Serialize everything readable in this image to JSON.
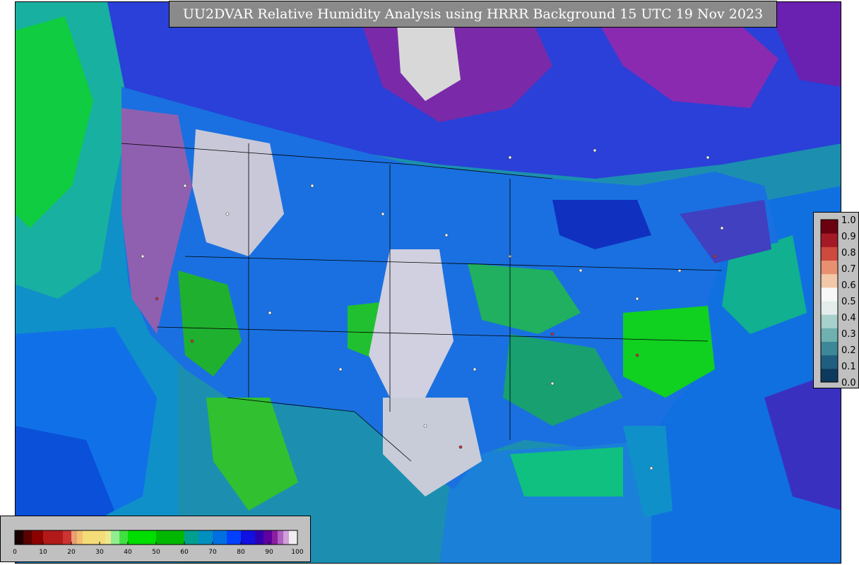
{
  "title": "UU2DVAR Relative Humidity Analysis using HRRR Background 15 UTC 19 Nov 2023",
  "rh_colorbar": {
    "ticks": [
      "0",
      "10",
      "20",
      "30",
      "40",
      "50",
      "60",
      "70",
      "80",
      "90",
      "100"
    ],
    "range": [
      0,
      100
    ],
    "colors": [
      {
        "from": 0,
        "to": 3,
        "color": "#1a0000"
      },
      {
        "from": 3,
        "to": 6,
        "color": "#5a0000"
      },
      {
        "from": 6,
        "to": 10,
        "color": "#8b0000"
      },
      {
        "from": 10,
        "to": 17,
        "color": "#b21a1a"
      },
      {
        "from": 17,
        "to": 20,
        "color": "#cc3333"
      },
      {
        "from": 20,
        "to": 22,
        "color": "#e8a070"
      },
      {
        "from": 22,
        "to": 24,
        "color": "#f2c070"
      },
      {
        "from": 24,
        "to": 32,
        "color": "#f4dc78"
      },
      {
        "from": 32,
        "to": 34,
        "color": "#f0e890"
      },
      {
        "from": 34,
        "to": 37,
        "color": "#90ee90"
      },
      {
        "from": 37,
        "to": 40,
        "color": "#40e040"
      },
      {
        "from": 40,
        "to": 50,
        "color": "#00dd00"
      },
      {
        "from": 50,
        "to": 60,
        "color": "#00b800"
      },
      {
        "from": 60,
        "to": 65,
        "color": "#00a090"
      },
      {
        "from": 65,
        "to": 70,
        "color": "#0090c0"
      },
      {
        "from": 70,
        "to": 75,
        "color": "#0070e0"
      },
      {
        "from": 75,
        "to": 80,
        "color": "#0040ff"
      },
      {
        "from": 80,
        "to": 85,
        "color": "#1010e0"
      },
      {
        "from": 85,
        "to": 88,
        "color": "#3000b0"
      },
      {
        "from": 88,
        "to": 91,
        "color": "#6000a0"
      },
      {
        "from": 91,
        "to": 93,
        "color": "#8a20a0"
      },
      {
        "from": 93,
        "to": 95,
        "color": "#b060c0"
      },
      {
        "from": 95,
        "to": 97,
        "color": "#d0a0d8"
      },
      {
        "from": 97,
        "to": 100,
        "color": "#eeeeee"
      }
    ]
  },
  "innovation_colorbar": {
    "ticks": [
      "0.0",
      "0.1",
      "0.2",
      "0.3",
      "0.4",
      "0.5",
      "0.6",
      "0.7",
      "0.8",
      "0.9",
      "1.0"
    ],
    "range": [
      0.0,
      1.0
    ],
    "colors": [
      "#0d3a5c",
      "#1f5e7e",
      "#3c8899",
      "#6fb0b0",
      "#a8d0cc",
      "#e4ecec",
      "#f8f8f8",
      "#f2c8a8",
      "#e89070",
      "#cc4a3e",
      "#a31a26",
      "#6b0010"
    ]
  },
  "colors": {
    "ocean_teal": "#1fa0a0",
    "ocean_blue": "#0070e0",
    "pacific_green": "#00cc00",
    "frame": "#000000",
    "title_bg": "#8a8a8a",
    "colorbar_bg": "#c0c0c0"
  }
}
